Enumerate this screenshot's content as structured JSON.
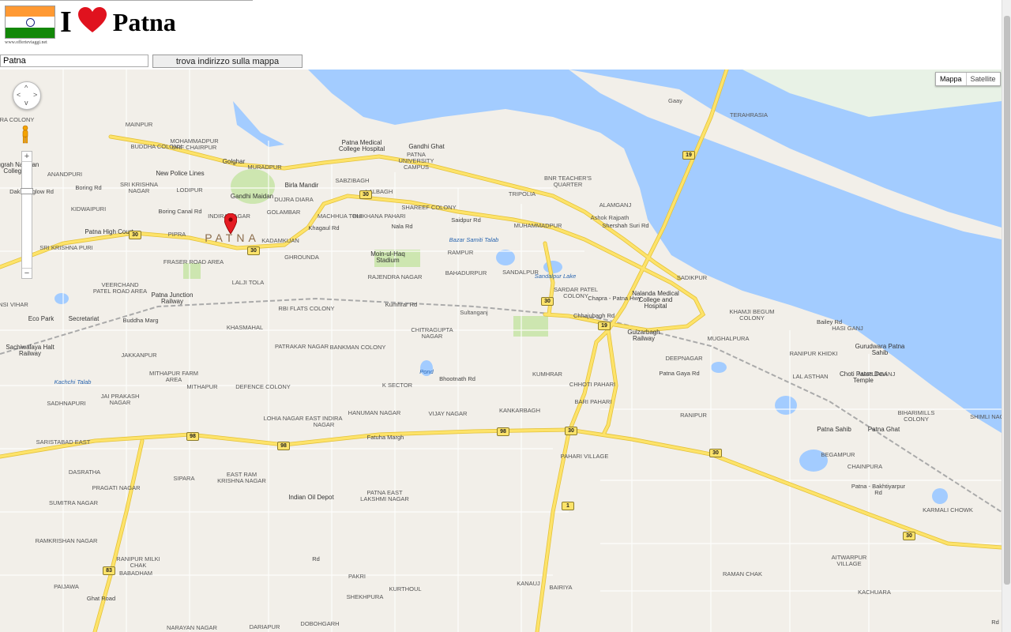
{
  "header": {
    "heart_text": "I",
    "city": "Patna",
    "site_url": "www.offerteviaggi.net",
    "flag_colors": [
      "#ff9933",
      "#ffffff",
      "#138808"
    ],
    "heart_color": "#e0121e"
  },
  "search": {
    "value": "Patna",
    "button_label": "trova indirizzo sulla mappa"
  },
  "map_controls": {
    "map_type_selected": "Mappa",
    "map_type_other": "Satellite",
    "zoom_in": "+",
    "zoom_out": "−",
    "pan_up": "^",
    "pan_down": "v",
    "pan_left": "<",
    "pan_right": ">"
  },
  "colors": {
    "water": "#a3ccff",
    "land": "#f2efe9",
    "major_road": "#fde36a",
    "major_road_edge": "#e4c23a",
    "minor_road": "#ffffff",
    "park": "#cde6b0"
  },
  "map": {
    "city_label": "PATNA",
    "labels": [
      "PUTRA COLONY",
      "MAINPUR",
      "BUDDHA COLONY",
      "MOHAMMADPUR URF CHAIRPUR",
      "Golghar",
      "New Police Lines",
      "MURADPUR",
      "Patna Medical College Hospital",
      "Gandhi Ghat",
      "PATNA UNIVERSITY CAMPUS",
      "BNR TEACHER'S QUARTER",
      "TERAHRASIA",
      "Anugrah Narayan College",
      "ANANDPURI",
      "SRI KRISHNA NAGAR",
      "LODIPUR",
      "Gandhi Maidan",
      "Birla Mandir",
      "SABZIBAGH",
      "DUJRA DIARA",
      "LALBAGH",
      "TRIPOLIA",
      "ALAMGANJ",
      "KIDWAIPURI",
      "INDIRA NAGAR",
      "GOLAMBAR",
      "MACHHUA TOLI",
      "BHIKHANA PAHARI",
      "SHAREEF COLONY",
      "Ashok Rajpath",
      "Patna High Court",
      "SRI KRISHNA PURI",
      "MUHAMMADPUR",
      "KADAMKUAN",
      "GHROUNDA",
      "Moin-ul-Haq Stadium",
      "Bazar Samiti Talab",
      "RAMPUR",
      "FRASER ROAD AREA",
      "RAJENDRA NAGAR",
      "BAHADURPUR",
      "SANDALPUR",
      "Sandalpur Lake",
      "SADIKPUR",
      "VEERCHAND PATEL ROAD AREA",
      "LALJI TOLA",
      "Patna Junction Railway",
      "SARDAR PATEL COLONY",
      "Nalanda Medical College and Hospital",
      "BANSI VIHAR",
      "Eco Park",
      "Secretariat",
      "RBI FLATS COLONY",
      "Kumhrar Rd",
      "KHAMJI BEGUM COLONY",
      "HASI GANJ",
      "KHASMAHAL",
      "CHITRAGUPTA NAGAR",
      "Gulzarbagh Railway",
      "MUGHALPURA",
      "Sachiwalaya Halt Railway",
      "JAKKANPUR",
      "PATRAKAR NAGAR",
      "BANKMAN COLONY",
      "DEEPNAGAR",
      "RANIPUR KHIDKI",
      "Gurudwara Patna Sahib",
      "Kachchi Talab",
      "MITHAPUR FARM AREA",
      "Pond",
      "KUMHRAR",
      "CHHOTI PAHARI",
      "LAL ASTHAN",
      "Choti Patan Devi Temple",
      "MARUFGANJ",
      "MITHAPUR",
      "DEFENCE COLONY",
      "K SECTOR",
      "Bhootnath Rd",
      "BARI PAHARI",
      "SADHNAPURI",
      "JAI PRAKASH NAGAR",
      "KANKARBAGH",
      "RANIPUR",
      "BIHARIMILLS COLONY",
      "SHIMLI NAGAR",
      "LOHIA NAGAR",
      "EAST INDIRA NAGAR",
      "HANUMAN NAGAR",
      "VIJAY NAGAR",
      "Patna Sahib",
      "Patna Ghat",
      "SARISTABAD EAST",
      "Fatuha Margh",
      "BEGAMPUR",
      "CHAINPURA",
      "DASRATHA",
      "PRAGATI NAGAR",
      "SIPARA",
      "EAST RAM KRISHNA NAGAR",
      "PATNA EAST LAKSHMI NAGAR",
      "PAHARI VILLAGE",
      "Patna - Bakhtiyarpur Rd",
      "KARMALI CHOWK",
      "SUMITRA NAGAR",
      "Indian Oil Depot",
      "RAMKRISHAN NAGAR",
      "AITWARPUR VILLAGE",
      "RANIPUR MILKI CHAK",
      "BABADHAM",
      "PAKRI",
      "SHEKHPURA",
      "KANAUJ",
      "BAIRIYA",
      "RAMAN CHAK",
      "PAIJAWA",
      "KURTHOUL",
      "KACHUARA",
      "NARAYAN NAGAR",
      "DARIAPUR",
      "DOBOHGARH",
      "PIPRA",
      "Dak Bunglow Rd",
      "Boring Rd",
      "Boring Canal Rd",
      "Buddha Marg",
      "Khagaul Rd",
      "Nala Rd",
      "Saidpur Rd",
      "Shershah Suri Rd",
      "Chhajubagh Rd",
      "Gaay",
      "Chapra - Patna Hwy",
      "Ghat Road",
      "Patna Gaya Rd",
      "Bailey Rd",
      "Sultanganj",
      "Rd",
      "Rd",
      "Mithapur"
    ],
    "route_shields": [
      "30",
      "30",
      "30",
      "30",
      "19",
      "19",
      "98",
      "98",
      "98",
      "30",
      "30",
      "30",
      "83",
      "1"
    ]
  }
}
